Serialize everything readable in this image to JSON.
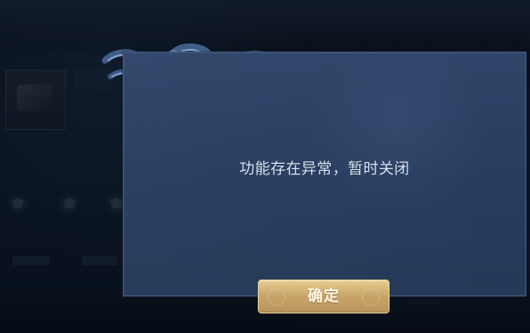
{
  "dialog": {
    "message": "功能存在异常，暂时关闭",
    "confirm_label": "确定"
  },
  "colors": {
    "dialog_bg": "#273d61",
    "dialog_border": "#41577f",
    "message_text": "#d6e0ef",
    "button_gold": "#d2b17a",
    "button_text": "#fff8e8",
    "background_dark": "#0b1524"
  },
  "icons": {
    "dialog_corner": "cloud-ornament-icon"
  }
}
